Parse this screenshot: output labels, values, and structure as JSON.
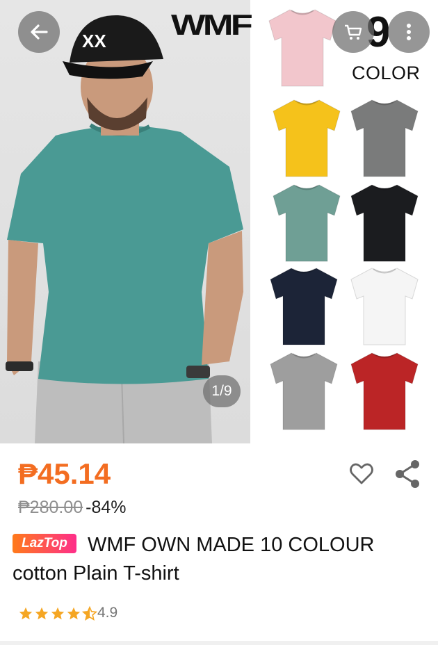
{
  "gallery": {
    "brand": "WMF",
    "color_count": "9",
    "color_label": "COLOR",
    "counter": "1/9",
    "swatch_colors": [
      "#f2c6cc",
      "#f5c21b",
      "#7a7b7b",
      "#6f9f95",
      "#1b1c1f",
      "#1c2437",
      "#f5f5f5",
      "#9e9e9e",
      "#bb2526"
    ],
    "model_shirt_color": "#4a9a94"
  },
  "nav": {
    "back_icon": "arrow-left-icon",
    "cart_icon": "cart-icon",
    "more_icon": "more-vertical-icon"
  },
  "product": {
    "price": "₱45.14",
    "original_price": "₱280.00",
    "discount": "-84%",
    "badge": "LazTop",
    "title": "WMF OWN MADE 10 COLOUR cotton Plain T-shirt",
    "rating": "4.9",
    "stars": 4.5,
    "accent_color": "#f36d21",
    "star_color": "#f5a623"
  }
}
